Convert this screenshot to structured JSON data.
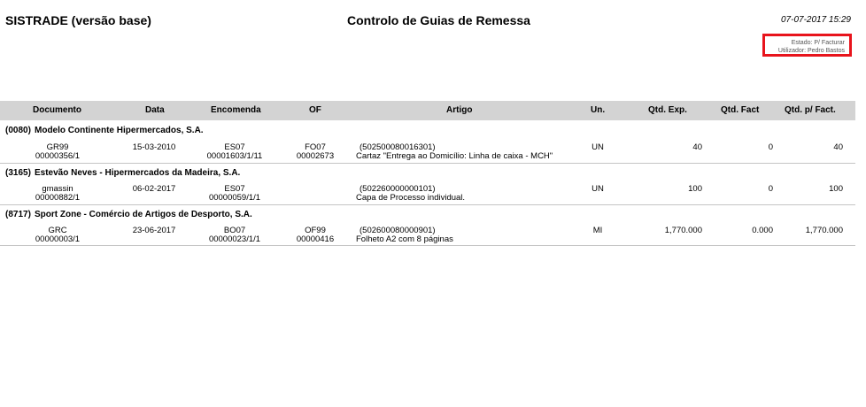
{
  "header": {
    "app_title": "SISTRADE (versão base)",
    "report_title": "Controlo de Guias de Remessa",
    "datetime": "07-07-2017 15:29",
    "estado": "Estado:  P/ Facturar",
    "utilizador": "Utilizador:  Pedro Bastos"
  },
  "columns": {
    "documento": "Documento",
    "data": "Data",
    "encomenda": "Encomenda",
    "of": "OF",
    "artigo": "Artigo",
    "un": "Un.",
    "qtd_exp": "Qtd. Exp.",
    "qtd_fact": "Qtd. Fact",
    "qtd_pfact": "Qtd. p/ Fact."
  },
  "groups": [
    {
      "code": "(0080)",
      "name": "Modelo Continente Hipermercados, S.A.",
      "row": {
        "doc_top": "GR99",
        "doc_bottom": "00000356/1",
        "data": "15-03-2010",
        "enc_top": "ES07",
        "enc_bottom": "00001603/1/11",
        "of_top": "FO07",
        "of_bottom": "00002673",
        "art_code": "(502500080016301)",
        "art_desc": "Cartaz \"Entrega ao Domicílio: Linha de caixa - MCH\"",
        "un": "UN",
        "qtd_exp": "40",
        "qtd_fact": "0",
        "qtd_pfact": "40"
      }
    },
    {
      "code": "(3165)",
      "name": "Estevão Neves - Hipermercados da Madeira, S.A.",
      "row": {
        "doc_top": "gmassin",
        "doc_bottom": "00000882/1",
        "data": "06-02-2017",
        "enc_top": "ES07",
        "enc_bottom": "00000059/1/1",
        "of_top": "",
        "of_bottom": "",
        "art_code": "(502260000000101)",
        "art_desc": "Capa de Processo individual.",
        "un": "UN",
        "qtd_exp": "100",
        "qtd_fact": "0",
        "qtd_pfact": "100"
      }
    },
    {
      "code": "(8717)",
      "name": "Sport Zone - Comércio de Artigos de Desporto, S.A.",
      "row": {
        "doc_top": "GRC",
        "doc_bottom": "00000003/1",
        "data": "23-06-2017",
        "enc_top": "BO07",
        "enc_bottom": "00000023/1/1",
        "of_top": "OF99",
        "of_bottom": "00000416",
        "art_code": "(502600080000901)",
        "art_desc": "Folheto A2 com 8 páginas",
        "un": "MI",
        "qtd_exp": "1,770.000",
        "qtd_fact": "0.000",
        "qtd_pfact": "1,770.000"
      }
    }
  ],
  "colors": {
    "header_bar": "#d3d3d3",
    "highlight_box": "#e8141c"
  }
}
